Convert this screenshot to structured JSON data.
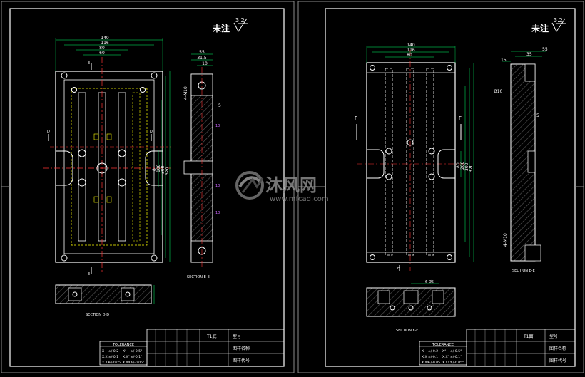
{
  "watermark": {
    "brand": "沐风网",
    "url": "www.mfcad.com"
  },
  "left_sheet": {
    "roughness_note": "未注",
    "roughness_value": "3.2",
    "dims_top": [
      "140",
      "116",
      "80",
      "60"
    ],
    "dims_side": [
      "8",
      "100",
      "300",
      "320"
    ],
    "side_view_dims": [
      "55",
      "31.5",
      "10"
    ],
    "side_view_labels": [
      "4-M10",
      "5",
      "10",
      "10",
      "10"
    ],
    "section_side": "SECTION E-E",
    "section_bottom": "SECTION D-D",
    "tolerance": {
      "header": "TOLERANCE",
      "rows": [
        [
          "X",
          "±/-0.2",
          "X°",
          "±/-0.5°"
        ],
        [
          "X.X",
          "±/-0.1",
          "X.X°",
          "±/-0.1°"
        ],
        [
          "X.XX",
          "±/-0.05",
          "X.XX°",
          "±/-0.05°"
        ]
      ]
    },
    "title_block": {
      "name": "T1底",
      "label_a": "型号",
      "label_b": "图样名称",
      "label_c": "图样代号"
    }
  },
  "right_sheet": {
    "roughness_note": "未注",
    "roughness_value": "3.2",
    "dims_top": [
      "140",
      "116",
      "80"
    ],
    "dims_side": [
      "80",
      "200",
      "300",
      "320"
    ],
    "side_view_dims": [
      "55",
      "35",
      "15"
    ],
    "side_view_labels": [
      "Ø10",
      "5",
      "4-M10"
    ],
    "section_side": "SECTION E-E",
    "section_bottom": "SECTION F-F",
    "section_bottom_dim": "6-Ø5",
    "tolerance": {
      "header": "TOLERANCE",
      "rows": [
        [
          "X",
          "±/-0.2",
          "X°",
          "±/-0.5°"
        ],
        [
          "X.X",
          "±/-0.1",
          "X.X°",
          "±/-0.1°"
        ],
        [
          "X.XX",
          "±/-0.05",
          "X.XX°",
          "±/-0.05°"
        ]
      ]
    },
    "title_block": {
      "name": "T1面",
      "label_a": "型号",
      "label_b": "图样名称",
      "label_c": "图样代号"
    }
  },
  "colors": {
    "outline": "#ffffff",
    "dimension": "#00ff66",
    "center": "#ff3333",
    "hidden": "#ffff00",
    "mark": "#cc66ff",
    "hatch": "#3a3a3a"
  }
}
